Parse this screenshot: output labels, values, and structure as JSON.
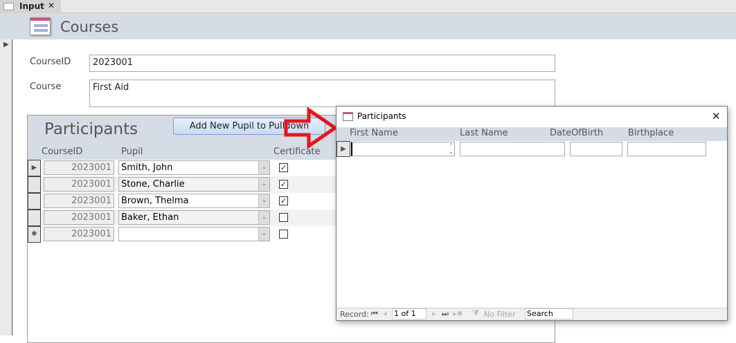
{
  "tab": {
    "title": "Input",
    "close": "✕"
  },
  "form": {
    "title": "Courses",
    "courseid_label": "CourseID",
    "courseid_value": "2023001",
    "course_label": "Course",
    "course_value": "First Aid"
  },
  "subform": {
    "title": "Participants",
    "button": "Add New Pupil to Pulldown",
    "columns": [
      "CourseID",
      "Pupil",
      "Certificate"
    ],
    "rows": [
      {
        "id": "2023001",
        "pupil": "Smith, John",
        "cert": true
      },
      {
        "id": "2023001",
        "pupil": "Stone, Charlie",
        "cert": true
      },
      {
        "id": "2023001",
        "pupil": "Brown, Thelma",
        "cert": true
      },
      {
        "id": "2023001",
        "pupil": "Baker, Ethan",
        "cert": false
      },
      {
        "id": "2023001",
        "pupil": "",
        "cert": false
      }
    ]
  },
  "popup": {
    "title": "Participants",
    "close": "✕",
    "columns": [
      "First Name",
      "Last Name",
      "DateOfBirth",
      "Birthplace"
    ],
    "status": {
      "record_label": "Record:",
      "position": "1 of 1",
      "filter": "No Filter",
      "search": "Search"
    }
  },
  "colors": {
    "header": "#d6dce5",
    "arrow": "#e8141c",
    "accent": "#c25a7a"
  }
}
